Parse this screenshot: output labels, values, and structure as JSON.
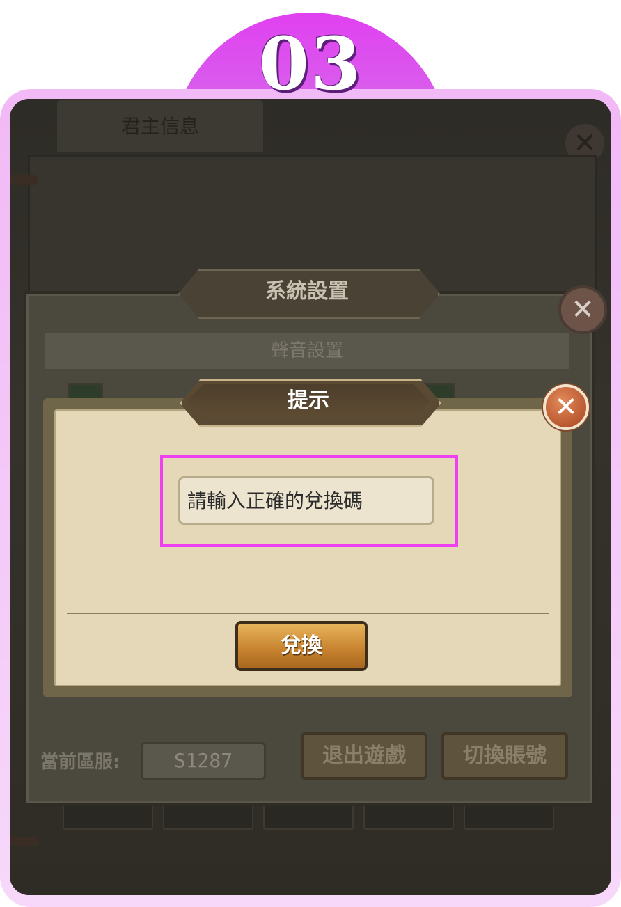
{
  "step": {
    "number": "03"
  },
  "background": {
    "tab_label": "君主信息",
    "close_glyph": "✕"
  },
  "settings": {
    "title": "系統設置",
    "close_glyph": "✕",
    "sound_header": "聲音設置",
    "server_label": "當前區服:",
    "server_value": "S1287",
    "exit_button": "退出遊戲",
    "switch_account_button": "切換賬號"
  },
  "dialog": {
    "title": "提示",
    "close_glyph": "✕",
    "input_placeholder": "請輸入正確的兌換碼",
    "redeem_button": "兌換"
  },
  "colors": {
    "frame_pink": "#f1b9f5",
    "highlight": "#ee3ff1",
    "dialog_bg": "#e5d8b8",
    "button_gold": "#c98531"
  }
}
